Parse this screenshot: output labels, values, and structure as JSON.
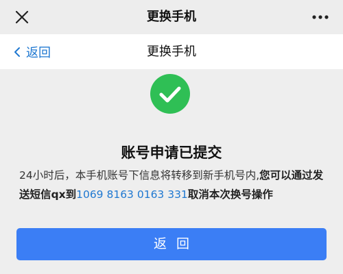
{
  "window": {
    "title": "更换手机",
    "close_icon": "close-icon",
    "more_icon": "more-dots-icon"
  },
  "navbar": {
    "back_label": "返回",
    "title": "更换手机"
  },
  "content": {
    "status_icon": "checkmark-circle-icon",
    "headline": "账号申请已提交",
    "message_part1": "24小时后，本手机账号下信息将转移到新手机号内,",
    "message_part2": "您可以通过发送短信qx到",
    "message_number": "1069 8163 0163 331",
    "message_part3": "取消本次换号操作",
    "return_button": "返回"
  },
  "colors": {
    "accent": "#3b7ef5",
    "link": "#1f78d1",
    "success": "#2fbf55"
  }
}
